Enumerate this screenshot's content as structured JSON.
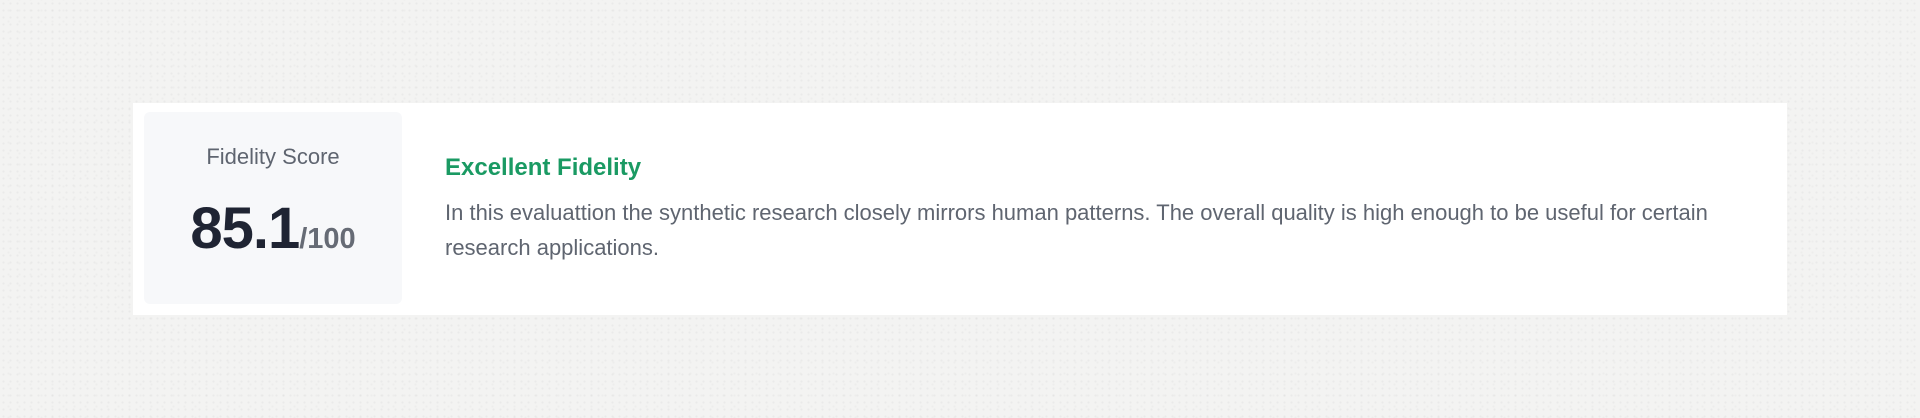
{
  "score_card": {
    "label": "Fidelity Score",
    "value": "85.1",
    "max": "/100"
  },
  "summary": {
    "title": "Excellent Fidelity",
    "text": "In this evaluattion the synthetic research closely mirrors human patterns. The overall quality is high enough to be useful for certain research applications."
  },
  "colors": {
    "accent_green": "#1a9a63",
    "score_text": "#1f2433",
    "muted_text": "#5f6570",
    "card_bg": "#ffffff",
    "score_box_bg": "#f7f8fa"
  }
}
